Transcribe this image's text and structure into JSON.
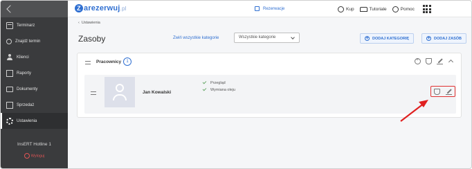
{
  "sidebar": {
    "items": [
      {
        "label": "Terminarz",
        "icon": "calendar-icon"
      },
      {
        "label": "Znajdź termin",
        "icon": "search-icon"
      },
      {
        "label": "Klienci",
        "icon": "users-icon"
      },
      {
        "label": "Raporty",
        "icon": "report-icon"
      },
      {
        "label": "Dokumenty",
        "icon": "folder-icon"
      },
      {
        "label": "Sprzedaż",
        "icon": "box-icon"
      },
      {
        "label": "Ustawienia",
        "icon": "gear-icon",
        "active": true
      }
    ],
    "company": "InsERT Hotline 1",
    "logout": "Wyloguj"
  },
  "topbar": {
    "logo_main": "arezerwuj",
    "logo_z": "Z",
    "logo_suffix": ".pl",
    "reservations": "Rezerwacje",
    "buy": "Kup",
    "tutorials": "Tutoriale",
    "help": "Pomoc"
  },
  "breadcrumb": "Ustawienia",
  "page_title": "Zasoby",
  "collapse_all": "Zwiń wszystkie kategorie",
  "category_select": "Wszystkie kategorie",
  "add_category": "DODAJ KATEGORIĘ",
  "add_resource": "DODAJ ZASÓB",
  "category": {
    "name": "Pracownicy",
    "count": "1",
    "resources": [
      {
        "name": "Jan Kowalski",
        "services": [
          "Przegląd",
          "Wymiana oleju"
        ]
      }
    ]
  },
  "colors": {
    "accent": "#2f6fd1",
    "sidebar": "#3a3b3d",
    "highlight": "#e03030"
  }
}
